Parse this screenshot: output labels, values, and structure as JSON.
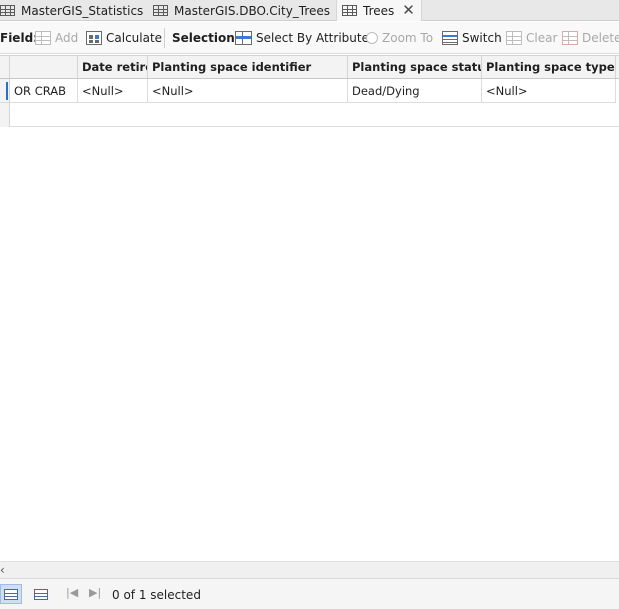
{
  "tabs": [
    {
      "label": "MasterGIS_Statistics",
      "active": false
    },
    {
      "label": "MasterGIS.DBO.City_Trees",
      "active": false
    },
    {
      "label": "Trees",
      "active": true
    }
  ],
  "toolbar": {
    "field_label": "Field:",
    "add_label": "Add",
    "calculate_label": "Calculate",
    "selection_label": "Selection:",
    "select_by_attributes_label": "Select By Attributes",
    "zoom_to_label": "Zoom To",
    "switch_label": "Switch",
    "clear_label": "Clear",
    "delete_label": "Delete"
  },
  "table": {
    "columns": [
      "",
      "Date retired",
      "Planting space identifier",
      "Planting space status",
      "Planting space type"
    ],
    "rows": [
      [
        "OR CRAB",
        "<Null>",
        "<Null>",
        "Dead/Dying",
        "<Null>"
      ]
    ]
  },
  "status": {
    "selected_text": "0 of 1 selected"
  },
  "colors": {
    "accent": "#2a6fc9",
    "header_bg": "#f3f3f3"
  }
}
